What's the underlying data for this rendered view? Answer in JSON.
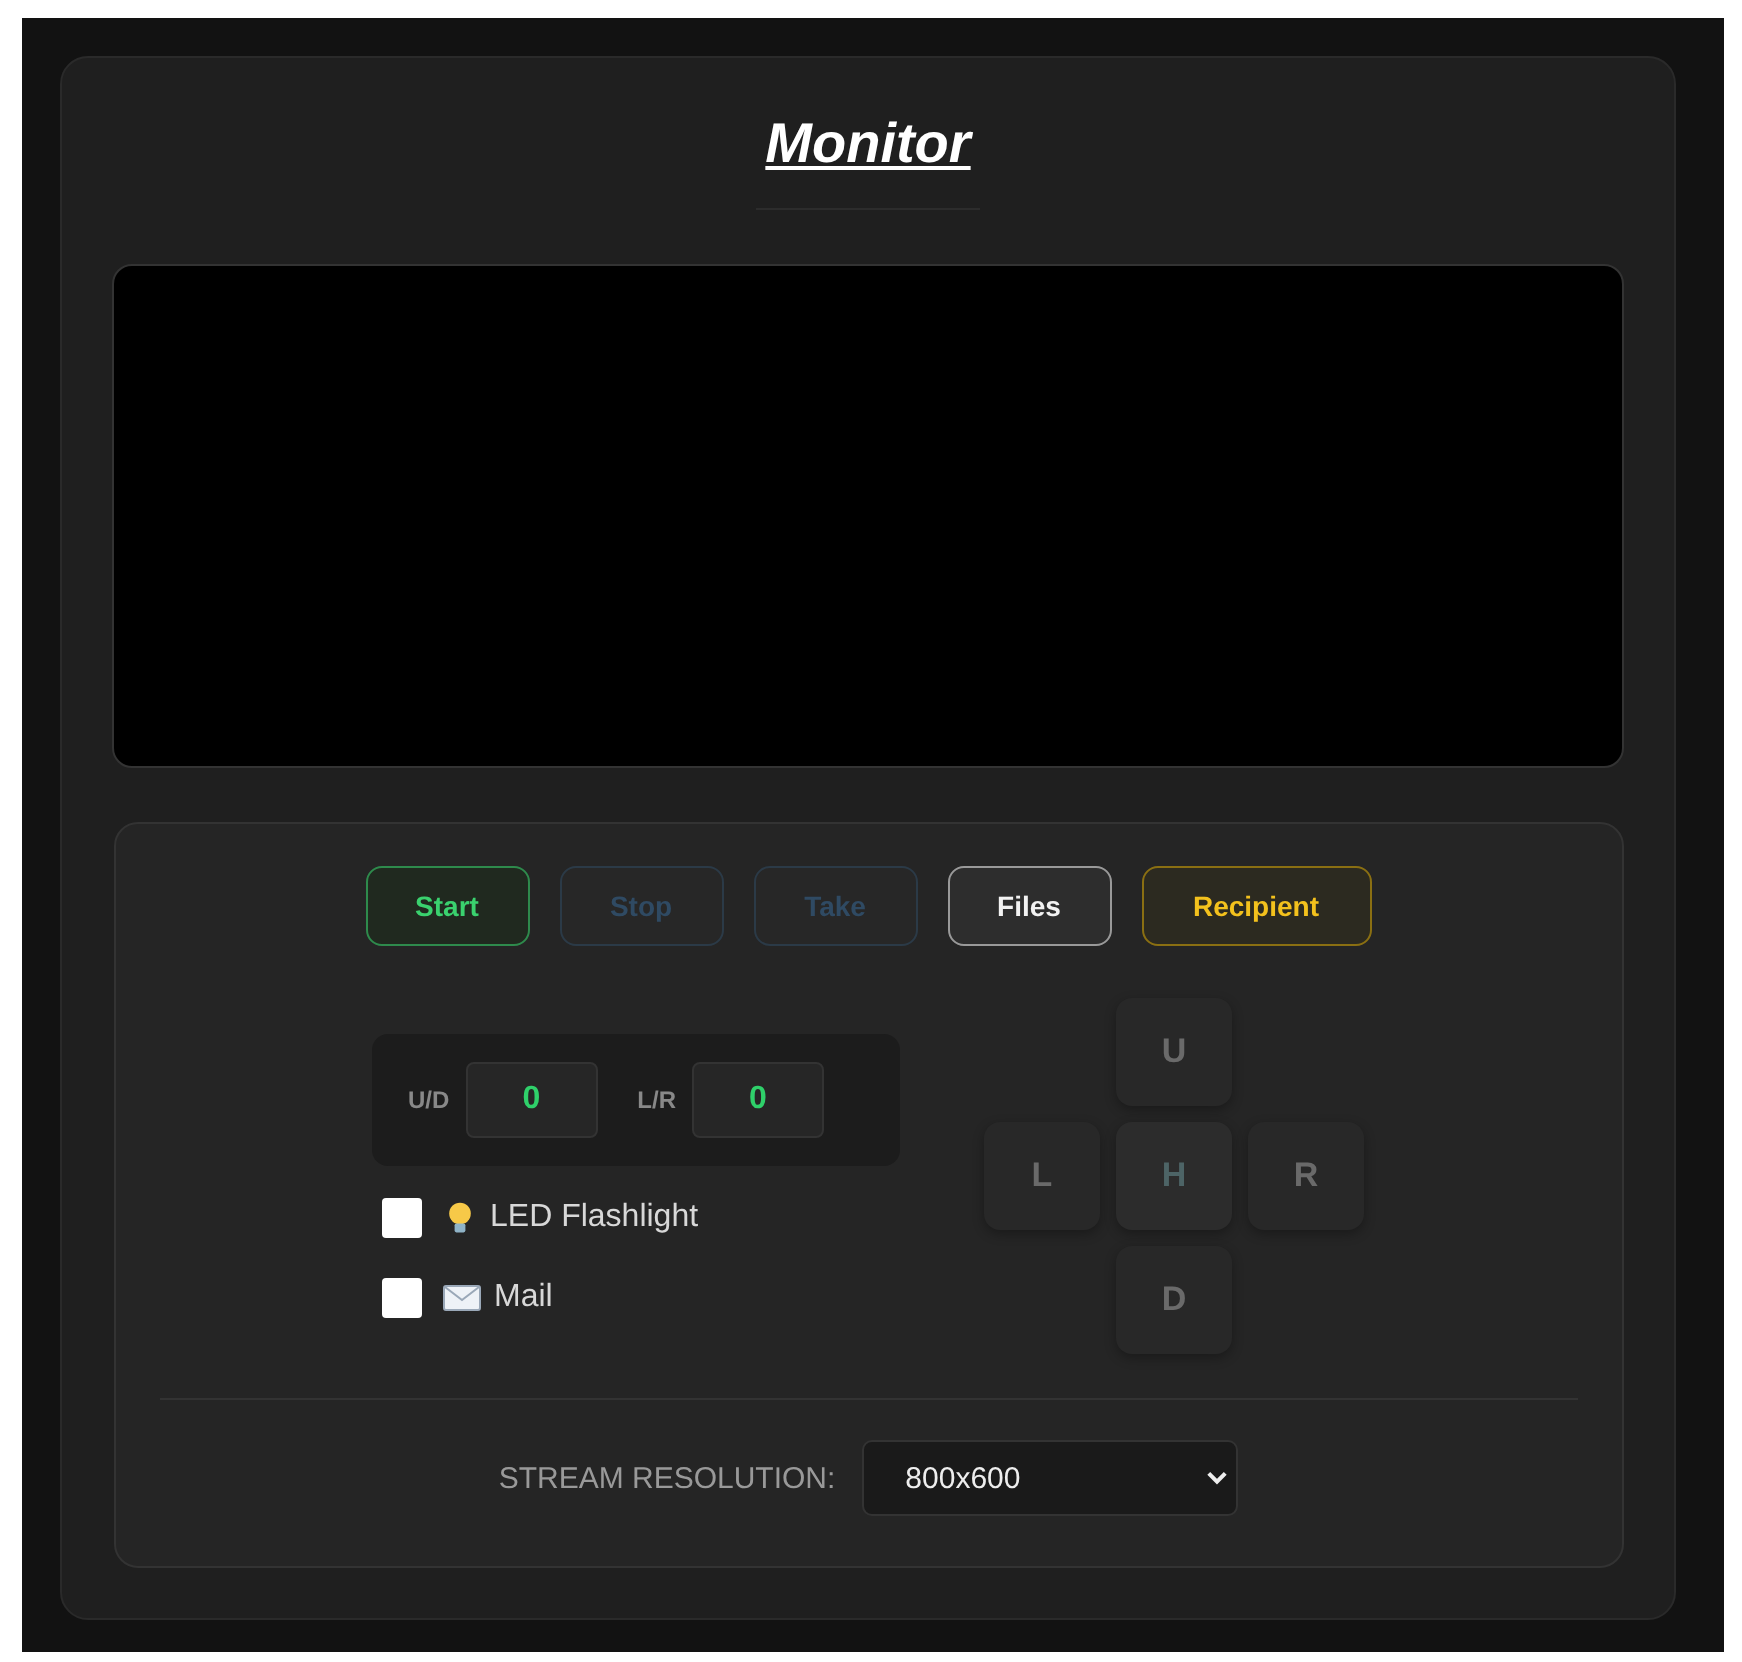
{
  "title": "Monitor",
  "buttons": [
    {
      "label": "Start",
      "kind": "start",
      "disabled": false
    },
    {
      "label": "Stop",
      "kind": "plain",
      "disabled": true
    },
    {
      "label": "Take",
      "kind": "plain",
      "disabled": true
    },
    {
      "label": "Files",
      "kind": "files",
      "disabled": false
    },
    {
      "label": "Recipient",
      "kind": "recipient",
      "disabled": false
    }
  ],
  "position": [
    {
      "label": "U/D",
      "value": "0"
    },
    {
      "label": "L/R",
      "value": "0"
    }
  ],
  "options": [
    {
      "label": "LED Flashlight",
      "kind": "bulb",
      "checked": false
    },
    {
      "label": "Mail",
      "kind": "mail",
      "checked": false
    }
  ],
  "dpad": [
    {
      "label": "U",
      "kind": "up"
    },
    {
      "label": "L",
      "kind": "left"
    },
    {
      "label": "H",
      "kind": "home"
    },
    {
      "label": "R",
      "kind": "right"
    },
    {
      "label": "D",
      "kind": "down"
    }
  ],
  "resolution": {
    "label": "STREAM RESOLUTION:",
    "value": "800x600"
  }
}
